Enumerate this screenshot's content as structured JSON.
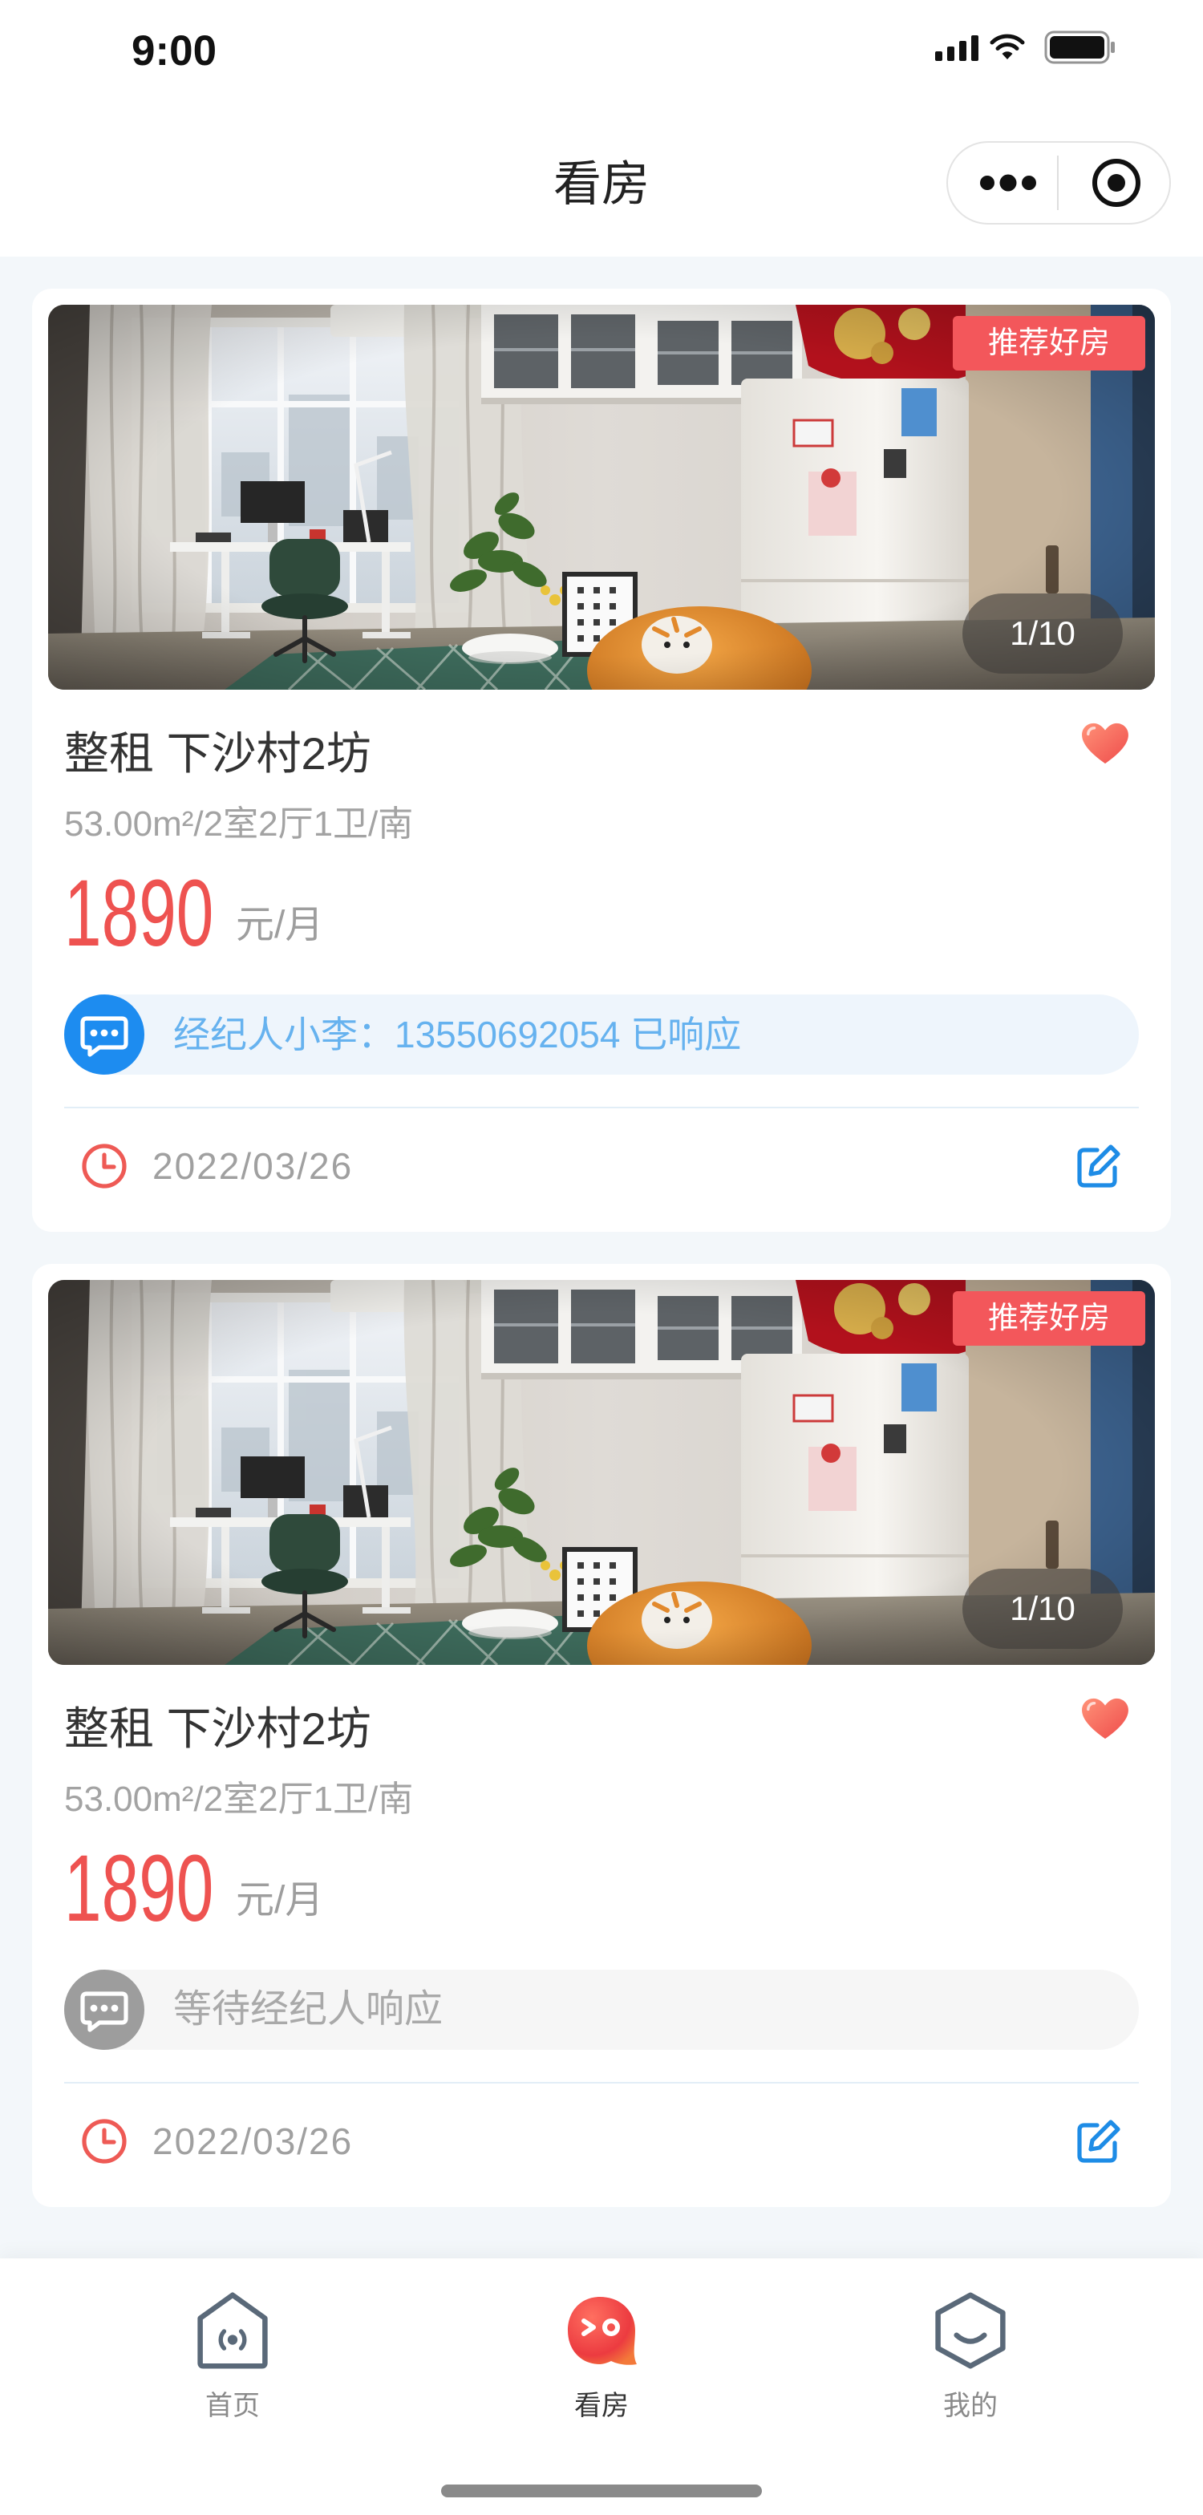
{
  "status_bar": {
    "time": "9:00",
    "icons": [
      "cellular-signal-icon",
      "wifi-icon",
      "battery-icon"
    ]
  },
  "nav": {
    "title": "看房",
    "capsule": {
      "more_icon": "more-dots-icon",
      "close_icon": "target-circle-icon"
    }
  },
  "listings": [
    {
      "badge": "推荐好房",
      "photo_counter": "1/10",
      "title": "整租 下沙村2坊",
      "spec": "53.00m²/2室2厅1卫/南",
      "price": "1890",
      "price_unit": "元/月",
      "favorited": true,
      "agent": {
        "text": "经纪人小李：13550692054 已响应",
        "responded": true,
        "icon": "chat-bubble-icon"
      },
      "date": "2022/03/26",
      "date_icon": "clock-icon",
      "edit_icon": "edit-icon"
    },
    {
      "badge": "推荐好房",
      "photo_counter": "1/10",
      "title": "整租 下沙村2坊",
      "spec": "53.00m²/2室2厅1卫/南",
      "price": "1890",
      "price_unit": "元/月",
      "favorited": true,
      "agent": {
        "text": "等待经纪人响应",
        "responded": false,
        "icon": "chat-bubble-icon"
      },
      "date": "2022/03/26",
      "date_icon": "clock-icon",
      "edit_icon": "edit-icon"
    }
  ],
  "tabbar": {
    "items": [
      {
        "label": "首页",
        "icon": "home-icon",
        "active": false
      },
      {
        "label": "看房",
        "icon": "viewing-mascot-icon",
        "active": true
      },
      {
        "label": "我的",
        "icon": "profile-hexagon-icon",
        "active": false
      }
    ]
  },
  "colors": {
    "page_background": "#f3f7fa",
    "price": "#ee5250",
    "badge": "#f3575b",
    "agent_responded_text": "#66b2ef",
    "agent_responded_icon": "#1d8cf0",
    "agent_pending": "#9d9d9d",
    "clock_icon": "#ee5a55",
    "edit_icon": "#1e8ce6",
    "tab_icon": "#5a6979",
    "tab_active_icon": "#ee4443"
  }
}
